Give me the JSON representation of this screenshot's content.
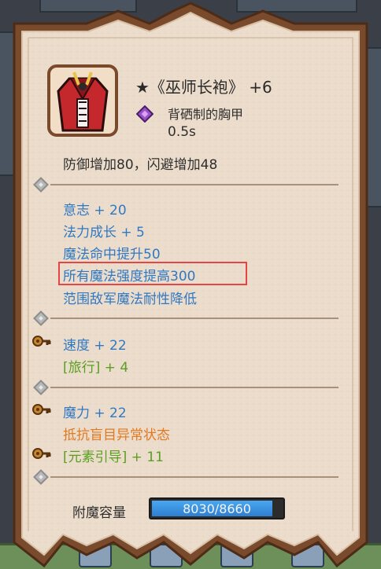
{
  "item": {
    "icon": "red-robe-icon",
    "title": "★《巫师长袍》 +6",
    "type_icon": "purple-gem-icon",
    "type": "背硒制的胸甲",
    "cast_time": "0.5s",
    "base_stats": "防御增加80，闪避增加48"
  },
  "section1": {
    "lines": [
      "意志 + 20",
      "法力成长 + 5",
      "魔法命中提升50",
      "所有魔法强度提高300",
      "范围敌军魔法耐性降低"
    ]
  },
  "section2": {
    "stat": "速度 + 22",
    "bonus": "[旅行] + 4"
  },
  "section3": {
    "stat": "魔力 + 22",
    "effect": "抵抗盲目异常状态",
    "bonus": "[元素引导] + 11"
  },
  "enchant": {
    "label": "附魔容量",
    "value_text": "8030/8660",
    "fill_fraction": 0.927
  },
  "colors": {
    "card_bg": "#ecdccb",
    "card_border": "#7a4a2d",
    "blue_text": "#2f79c4",
    "green_text": "#5a9f22",
    "orange_text": "#e07a23",
    "highlight": "#e64545"
  }
}
